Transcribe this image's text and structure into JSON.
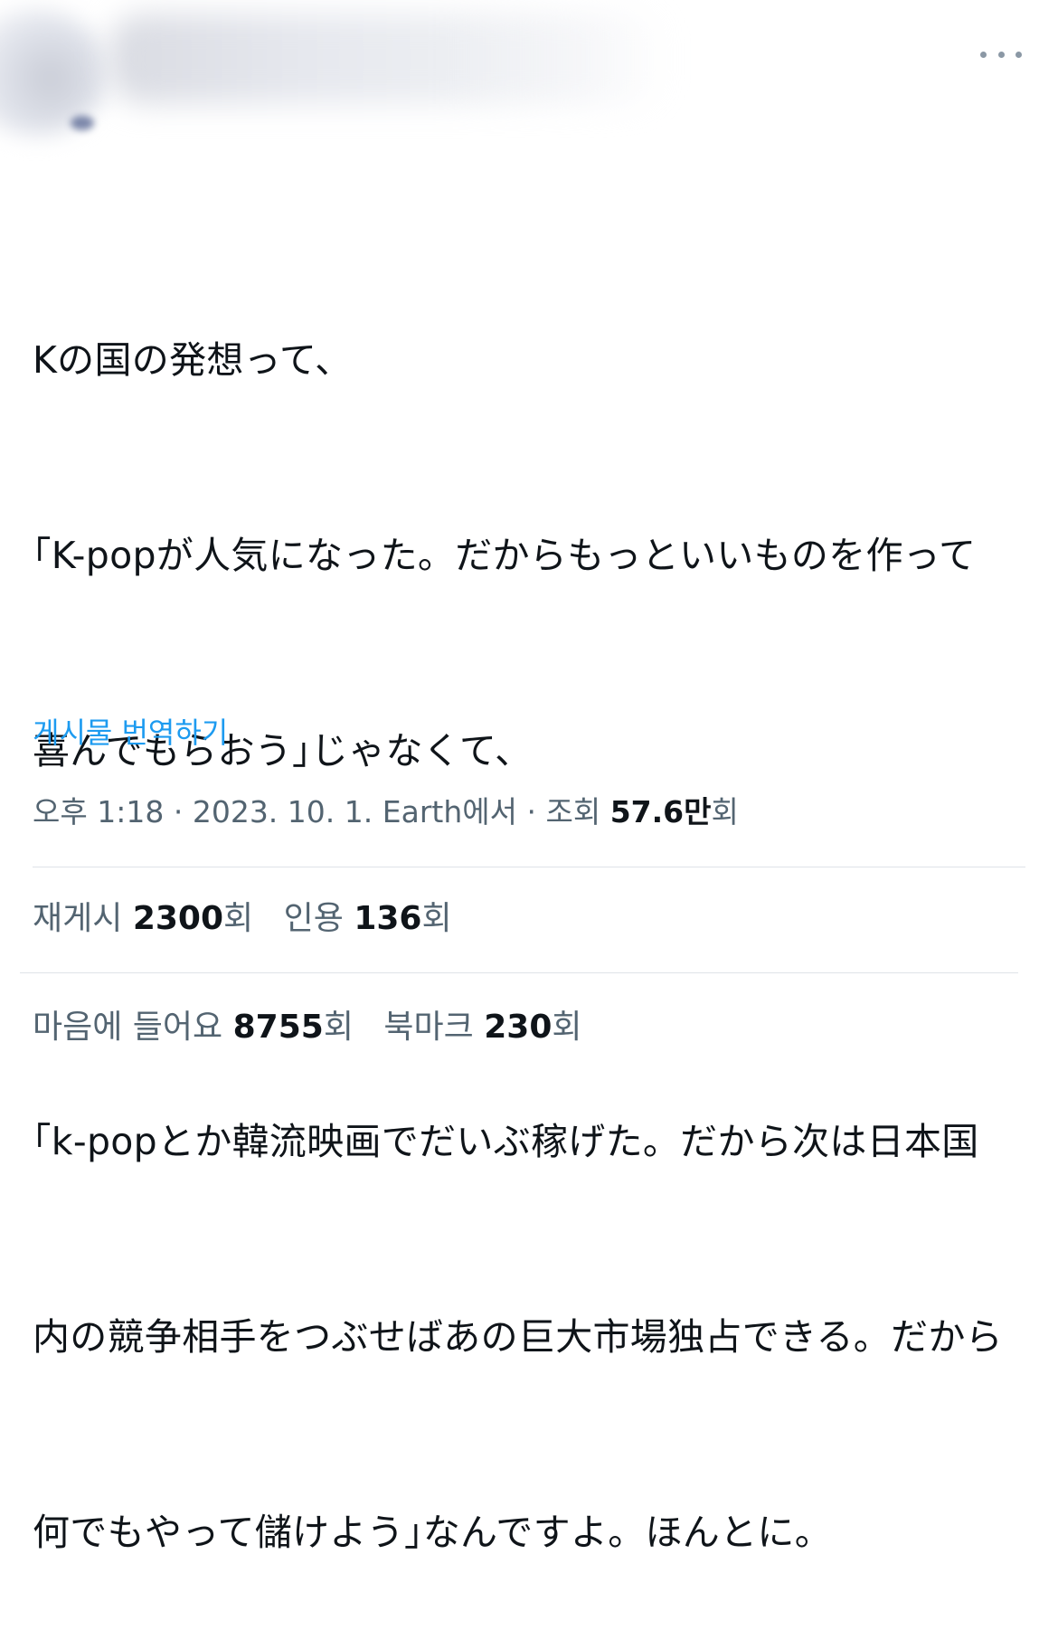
{
  "tweet": {
    "lines": [
      "Kの国の発想って、",
      "｢K-popが人気になった。だからもっといいものを作って",
      "喜んでもらおう｣じゃなくて、",
      "",
      "｢k-popとか韓流映画でだいぶ稼げた。だから次は日本国",
      "内の競争相手をつぶせばあの巨大市場独占できる。だから",
      "何でもやって儲けよう｣なんですよ。ほんとに。"
    ],
    "translate_label": "게시물 번역하기"
  },
  "meta": {
    "time": "오후 1:18",
    "separator": "·",
    "date": "2023. 10. 1.",
    "source": "Earth에서",
    "views_label": "조회",
    "views_value": "57.6만",
    "views_suffix": "회"
  },
  "stats": {
    "reposts_label": "재게시",
    "reposts_value": "2300",
    "quotes_label": "인용",
    "quotes_value": "136",
    "likes_label": "마음에 들어요",
    "likes_value": "8755",
    "bookmarks_label": "북마크",
    "bookmarks_value": "230",
    "count_suffix": "회"
  },
  "icons": {
    "more": "more-horizontal-icon"
  },
  "colors": {
    "text": "#0f1419",
    "secondary": "#536471",
    "link": "#1d9bf0",
    "divider": "#dfe3e8"
  }
}
